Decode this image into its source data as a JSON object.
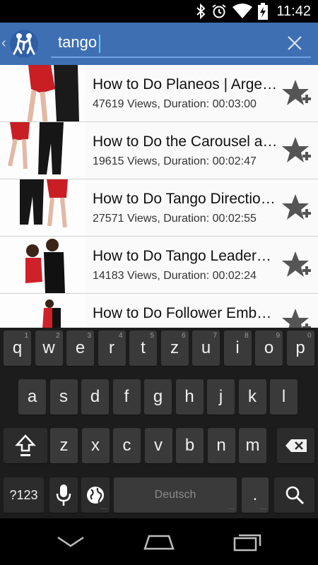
{
  "status_bar": {
    "time": "11:42",
    "icons": [
      "bluetooth-icon",
      "alarm-icon",
      "wifi-icon",
      "battery-charging-icon"
    ]
  },
  "action_bar": {
    "logo_icon": "dancing-couple-logo-icon",
    "search_value": "tango",
    "clear_icon": "close-icon"
  },
  "results": [
    {
      "title": "How to Do Planeos | Arge…",
      "meta": "47619 Views, Duration: 00:03:00"
    },
    {
      "title": "How to Do the Carousel a…",
      "meta": "19615 Views, Duration: 00:02:47"
    },
    {
      "title": "How to Do Tango Directio…",
      "meta": "27571 Views, Duration: 00:02:55"
    },
    {
      "title": "How to Do Tango Leader…",
      "meta": "14183 Views, Duration: 00:02:24"
    },
    {
      "title": "How to Do Follower Emb…",
      "meta": ""
    }
  ],
  "keyboard": {
    "row1": [
      {
        "k": "q",
        "h": "1"
      },
      {
        "k": "w",
        "h": "2"
      },
      {
        "k": "e",
        "h": "3"
      },
      {
        "k": "r",
        "h": "4"
      },
      {
        "k": "t",
        "h": "5"
      },
      {
        "k": "z",
        "h": "6"
      },
      {
        "k": "u",
        "h": "7"
      },
      {
        "k": "i",
        "h": "8"
      },
      {
        "k": "o",
        "h": "9"
      },
      {
        "k": "p",
        "h": "0"
      }
    ],
    "row2": [
      "a",
      "s",
      "d",
      "f",
      "g",
      "h",
      "j",
      "k",
      "l"
    ],
    "row3": [
      "z",
      "x",
      "c",
      "v",
      "b",
      "n",
      "m"
    ],
    "symbols_label": "?123",
    "space_label": "Deutsch",
    "period_label": ".",
    "hint_dots": "…"
  },
  "colors": {
    "action_bar": "#3F6FB3",
    "search_underline": "#6fa4e4",
    "keyboard_bg": "#1c1c1c",
    "key_bg": "#3a3a3a"
  }
}
